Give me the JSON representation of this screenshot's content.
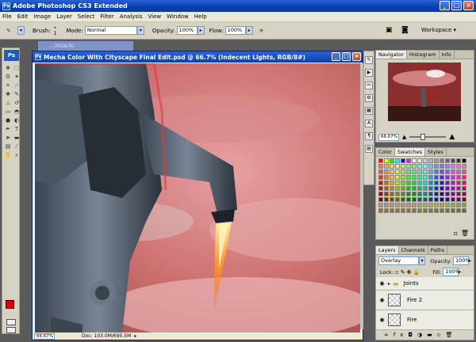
{
  "app": {
    "title": "Adobe Photoshop CS3 Extended",
    "logo": "Ps"
  },
  "menu": [
    "File",
    "Edit",
    "Image",
    "Layer",
    "Select",
    "Filter",
    "Analysis",
    "View",
    "Window",
    "Help"
  ],
  "options": {
    "brush_label": "Brush:",
    "brush_size": "1",
    "mode_label": "Mode:",
    "mode_value": "Normal",
    "opacity_label": "Opacity:",
    "opacity_value": "100%",
    "flow_label": "Flow:",
    "flow_value": "100%",
    "workspace_label": "Workspace"
  },
  "document": {
    "title": "Mecha Color With Cityscape Final Edit.psd @ 66.7% (Indecent Lights, RGB/8#)",
    "back_title": "...(RGB/8)",
    "zoom": "66.67%",
    "doc_info": "Doc: 103.0M/695.5M"
  },
  "navigator": {
    "tabs": [
      "Navigator",
      "Histogram",
      "Info"
    ],
    "zoom": "66.67%",
    "zoom_fraction": 0.35
  },
  "color_panel": {
    "tabs": [
      "Color",
      "Swatches",
      "Styles"
    ]
  },
  "layers": {
    "tabs": [
      "Layers",
      "Channels",
      "Paths"
    ],
    "blend_mode": "Overlay",
    "opacity_label": "Opacity:",
    "opacity_value": "100%",
    "lock_label": "Lock:",
    "fill_label": "Fill:",
    "fill_value": "100%",
    "rows": [
      {
        "name": "Joints",
        "type": "group"
      },
      {
        "name": "Fire 2",
        "type": "layer"
      },
      {
        "name": "Fire",
        "type": "layer"
      }
    ]
  },
  "colors": {
    "accent": "#0b3fb0",
    "foreground": "#e00000",
    "background": "#ffffff"
  }
}
